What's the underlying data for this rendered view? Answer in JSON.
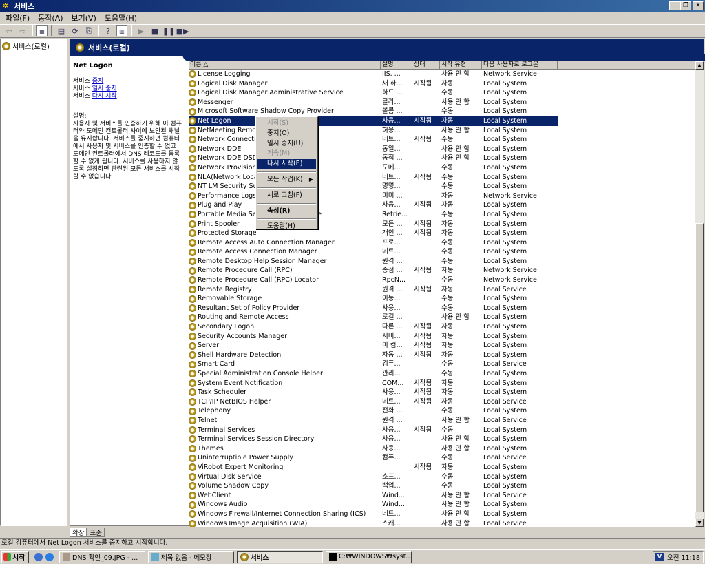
{
  "window": {
    "title": "서비스"
  },
  "menu": [
    "파일(F)",
    "동작(A)",
    "보기(V)",
    "도움말(H)"
  ],
  "tree": {
    "root": "서비스(로컬)"
  },
  "header": {
    "title": "서비스(로컬)"
  },
  "detail": {
    "title": "Net Logon",
    "actions": [
      {
        "prefix": "서비스 ",
        "link": "중지"
      },
      {
        "prefix": "서비스 ",
        "link": "일시 중지"
      },
      {
        "prefix": "서비스 ",
        "link": "다시 시작"
      }
    ],
    "desc_label": "설명:",
    "desc_text": "사용자 및 서비스를 인증하기 위해 이 컴퓨터와 도메인 컨트롤러 사이에 보안된 채널을 유지합니다. 서비스를 중지하면 컴퓨터에서 사용자 및 서비스를 인증할 수 없고 도메인 컨트롤러에서 DNS 레코드를 등록할 수 없게 됩니다. 서비스를 사용하지 않도록 설정하면 관련된 모든 서비스를 시작할 수 없습니다."
  },
  "columns": [
    "이름 △",
    "설명",
    "상태",
    "시작 유형",
    "다음 사용자로 로그온"
  ],
  "services": [
    {
      "name": "License Logging",
      "desc": "IIS. ...",
      "status": "",
      "startup": "사용 안 함",
      "logon": "Network Service"
    },
    {
      "name": "Logical Disk Manager",
      "desc": "새 하...",
      "status": "시작됨",
      "startup": "자동",
      "logon": "Local System"
    },
    {
      "name": "Logical Disk Manager Administrative Service",
      "desc": "하드 ...",
      "status": "",
      "startup": "수동",
      "logon": "Local System"
    },
    {
      "name": "Messenger",
      "desc": "클라...",
      "status": "",
      "startup": "사용 안 함",
      "logon": "Local System"
    },
    {
      "name": "Microsoft Software Shadow Copy Provider",
      "desc": "볼륨 ...",
      "status": "",
      "startup": "수동",
      "logon": "Local System"
    },
    {
      "name": "Net Logon",
      "desc": "사용...",
      "status": "시작됨",
      "startup": "자동",
      "logon": "Local System"
    },
    {
      "name": "NetMeeting Remote Desktop Sharing",
      "desc": "허용...",
      "status": "",
      "startup": "사용 안 함",
      "logon": "Local System"
    },
    {
      "name": "Network Connections",
      "desc": "네트...",
      "status": "시작됨",
      "startup": "수동",
      "logon": "Local System"
    },
    {
      "name": "Network DDE",
      "desc": "동일...",
      "status": "",
      "startup": "사용 안 함",
      "logon": "Local System"
    },
    {
      "name": "Network DDE DSDM",
      "desc": "동적 ...",
      "status": "",
      "startup": "사용 안 함",
      "logon": "Local System"
    },
    {
      "name": "Network Provisioning Service",
      "desc": "도메...",
      "status": "",
      "startup": "수동",
      "logon": "Local System"
    },
    {
      "name": "NLA(Network Location Awareness)",
      "desc": "네트...",
      "status": "시작됨",
      "startup": "수동",
      "logon": "Local System"
    },
    {
      "name": "NT LM Security Support Provider",
      "desc": "명명...",
      "status": "",
      "startup": "수동",
      "logon": "Local System"
    },
    {
      "name": "Performance Logs and Alerts",
      "desc": "미미 ...",
      "status": "",
      "startup": "자동",
      "logon": "Network Service"
    },
    {
      "name": "Plug and Play",
      "desc": "사용...",
      "status": "시작됨",
      "startup": "자동",
      "logon": "Local System"
    },
    {
      "name": "Portable Media Serial Number Service",
      "desc": "Retrie...",
      "status": "",
      "startup": "수동",
      "logon": "Local System"
    },
    {
      "name": "Print Spooler",
      "desc": "모든 ...",
      "status": "시작됨",
      "startup": "자동",
      "logon": "Local System"
    },
    {
      "name": "Protected Storage",
      "desc": "개인 ...",
      "status": "시작됨",
      "startup": "자동",
      "logon": "Local System"
    },
    {
      "name": "Remote Access Auto Connection Manager",
      "desc": "프로...",
      "status": "",
      "startup": "수동",
      "logon": "Local System"
    },
    {
      "name": "Remote Access Connection Manager",
      "desc": "네트...",
      "status": "",
      "startup": "수동",
      "logon": "Local System"
    },
    {
      "name": "Remote Desktop Help Session Manager",
      "desc": "원격 ...",
      "status": "",
      "startup": "수동",
      "logon": "Local System"
    },
    {
      "name": "Remote Procedure Call (RPC)",
      "desc": "종점 ...",
      "status": "시작됨",
      "startup": "자동",
      "logon": "Network Service"
    },
    {
      "name": "Remote Procedure Call (RPC) Locator",
      "desc": "RpcN...",
      "status": "",
      "startup": "수동",
      "logon": "Network Service"
    },
    {
      "name": "Remote Registry",
      "desc": "원격 ...",
      "status": "시작됨",
      "startup": "자동",
      "logon": "Local Service"
    },
    {
      "name": "Removable Storage",
      "desc": "이동...",
      "status": "",
      "startup": "수동",
      "logon": "Local System"
    },
    {
      "name": "Resultant Set of Policy Provider",
      "desc": "사용...",
      "status": "",
      "startup": "수동",
      "logon": "Local System"
    },
    {
      "name": "Routing and Remote Access",
      "desc": "로컬 ...",
      "status": "",
      "startup": "사용 안 함",
      "logon": "Local System"
    },
    {
      "name": "Secondary Logon",
      "desc": "다른 ...",
      "status": "시작됨",
      "startup": "자동",
      "logon": "Local System"
    },
    {
      "name": "Security Accounts Manager",
      "desc": "서비...",
      "status": "시작됨",
      "startup": "자동",
      "logon": "Local System"
    },
    {
      "name": "Server",
      "desc": "이 컴...",
      "status": "시작됨",
      "startup": "자동",
      "logon": "Local System"
    },
    {
      "name": "Shell Hardware Detection",
      "desc": "자동 ...",
      "status": "시작됨",
      "startup": "자동",
      "logon": "Local System"
    },
    {
      "name": "Smart Card",
      "desc": "컴퓨...",
      "status": "",
      "startup": "수동",
      "logon": "Local Service"
    },
    {
      "name": "Special Administration Console Helper",
      "desc": "관리...",
      "status": "",
      "startup": "수동",
      "logon": "Local System"
    },
    {
      "name": "System Event Notification",
      "desc": "COM...",
      "status": "시작됨",
      "startup": "자동",
      "logon": "Local System"
    },
    {
      "name": "Task Scheduler",
      "desc": "사용...",
      "status": "시작됨",
      "startup": "자동",
      "logon": "Local System"
    },
    {
      "name": "TCP/IP NetBIOS Helper",
      "desc": "네트...",
      "status": "시작됨",
      "startup": "자동",
      "logon": "Local Service"
    },
    {
      "name": "Telephony",
      "desc": "전화 ...",
      "status": "",
      "startup": "수동",
      "logon": "Local System"
    },
    {
      "name": "Telnet",
      "desc": "원격 ...",
      "status": "",
      "startup": "사용 안 함",
      "logon": "Local Service"
    },
    {
      "name": "Terminal Services",
      "desc": "사용...",
      "status": "시작됨",
      "startup": "수동",
      "logon": "Local System"
    },
    {
      "name": "Terminal Services Session Directory",
      "desc": "사용...",
      "status": "",
      "startup": "사용 안 함",
      "logon": "Local System"
    },
    {
      "name": "Themes",
      "desc": "사용...",
      "status": "",
      "startup": "사용 안 함",
      "logon": "Local System"
    },
    {
      "name": "Uninterruptible Power Supply",
      "desc": "컴퓨...",
      "status": "",
      "startup": "수동",
      "logon": "Local Service"
    },
    {
      "name": "ViRobot Expert Monitoring",
      "desc": "",
      "status": "시작됨",
      "startup": "자동",
      "logon": "Local System"
    },
    {
      "name": "Virtual Disk Service",
      "desc": "소프...",
      "status": "",
      "startup": "수동",
      "logon": "Local System"
    },
    {
      "name": "Volume Shadow Copy",
      "desc": "백업...",
      "status": "",
      "startup": "수동",
      "logon": "Local System"
    },
    {
      "name": "WebClient",
      "desc": "Wind...",
      "status": "",
      "startup": "사용 안 함",
      "logon": "Local Service"
    },
    {
      "name": "Windows Audio",
      "desc": "Wind...",
      "status": "",
      "startup": "사용 안 함",
      "logon": "Local System"
    },
    {
      "name": "Windows Firewall/Internet Connection Sharing (ICS)",
      "desc": "네트...",
      "status": "",
      "startup": "사용 안 함",
      "logon": "Local System"
    },
    {
      "name": "Windows Image Acquisition (WIA)",
      "desc": "스캐...",
      "status": "",
      "startup": "사용 안 함",
      "logon": "Local Service"
    }
  ],
  "selected_index": 5,
  "context_menu": [
    {
      "label": "시작(S)",
      "state": "disabled"
    },
    {
      "label": "중지(O)",
      "state": "normal"
    },
    {
      "label": "일시 중지(U)",
      "state": "normal"
    },
    {
      "label": "계속(M)",
      "state": "disabled"
    },
    {
      "label": "다시 시작(E)",
      "state": "highlight"
    },
    {
      "sep": true
    },
    {
      "label": "모든 작업(K)",
      "state": "normal",
      "submenu": true
    },
    {
      "sep": true
    },
    {
      "label": "새로 고침(F)",
      "state": "normal"
    },
    {
      "sep": true
    },
    {
      "label": "속성(R)",
      "state": "bold"
    },
    {
      "sep": true
    },
    {
      "label": "도움말(H)",
      "state": "normal"
    }
  ],
  "tabs": [
    "확장",
    "표준"
  ],
  "active_tab": 0,
  "status": "로컬 컴퓨터에서 Net Logon 서비스를 중지하고 시작합니다.",
  "taskbar": {
    "start": "시작",
    "tasks": [
      "DNS 확인_09.JPG - ...",
      "제목 없음 - 메모장",
      "서비스",
      "C:₩WINDOWS₩syst..."
    ],
    "active_task": 2,
    "clock": "오전 11:18"
  },
  "colors": {
    "titlebar": "#0a246a",
    "selection": "#0a246a",
    "face": "#d4d0c8"
  }
}
